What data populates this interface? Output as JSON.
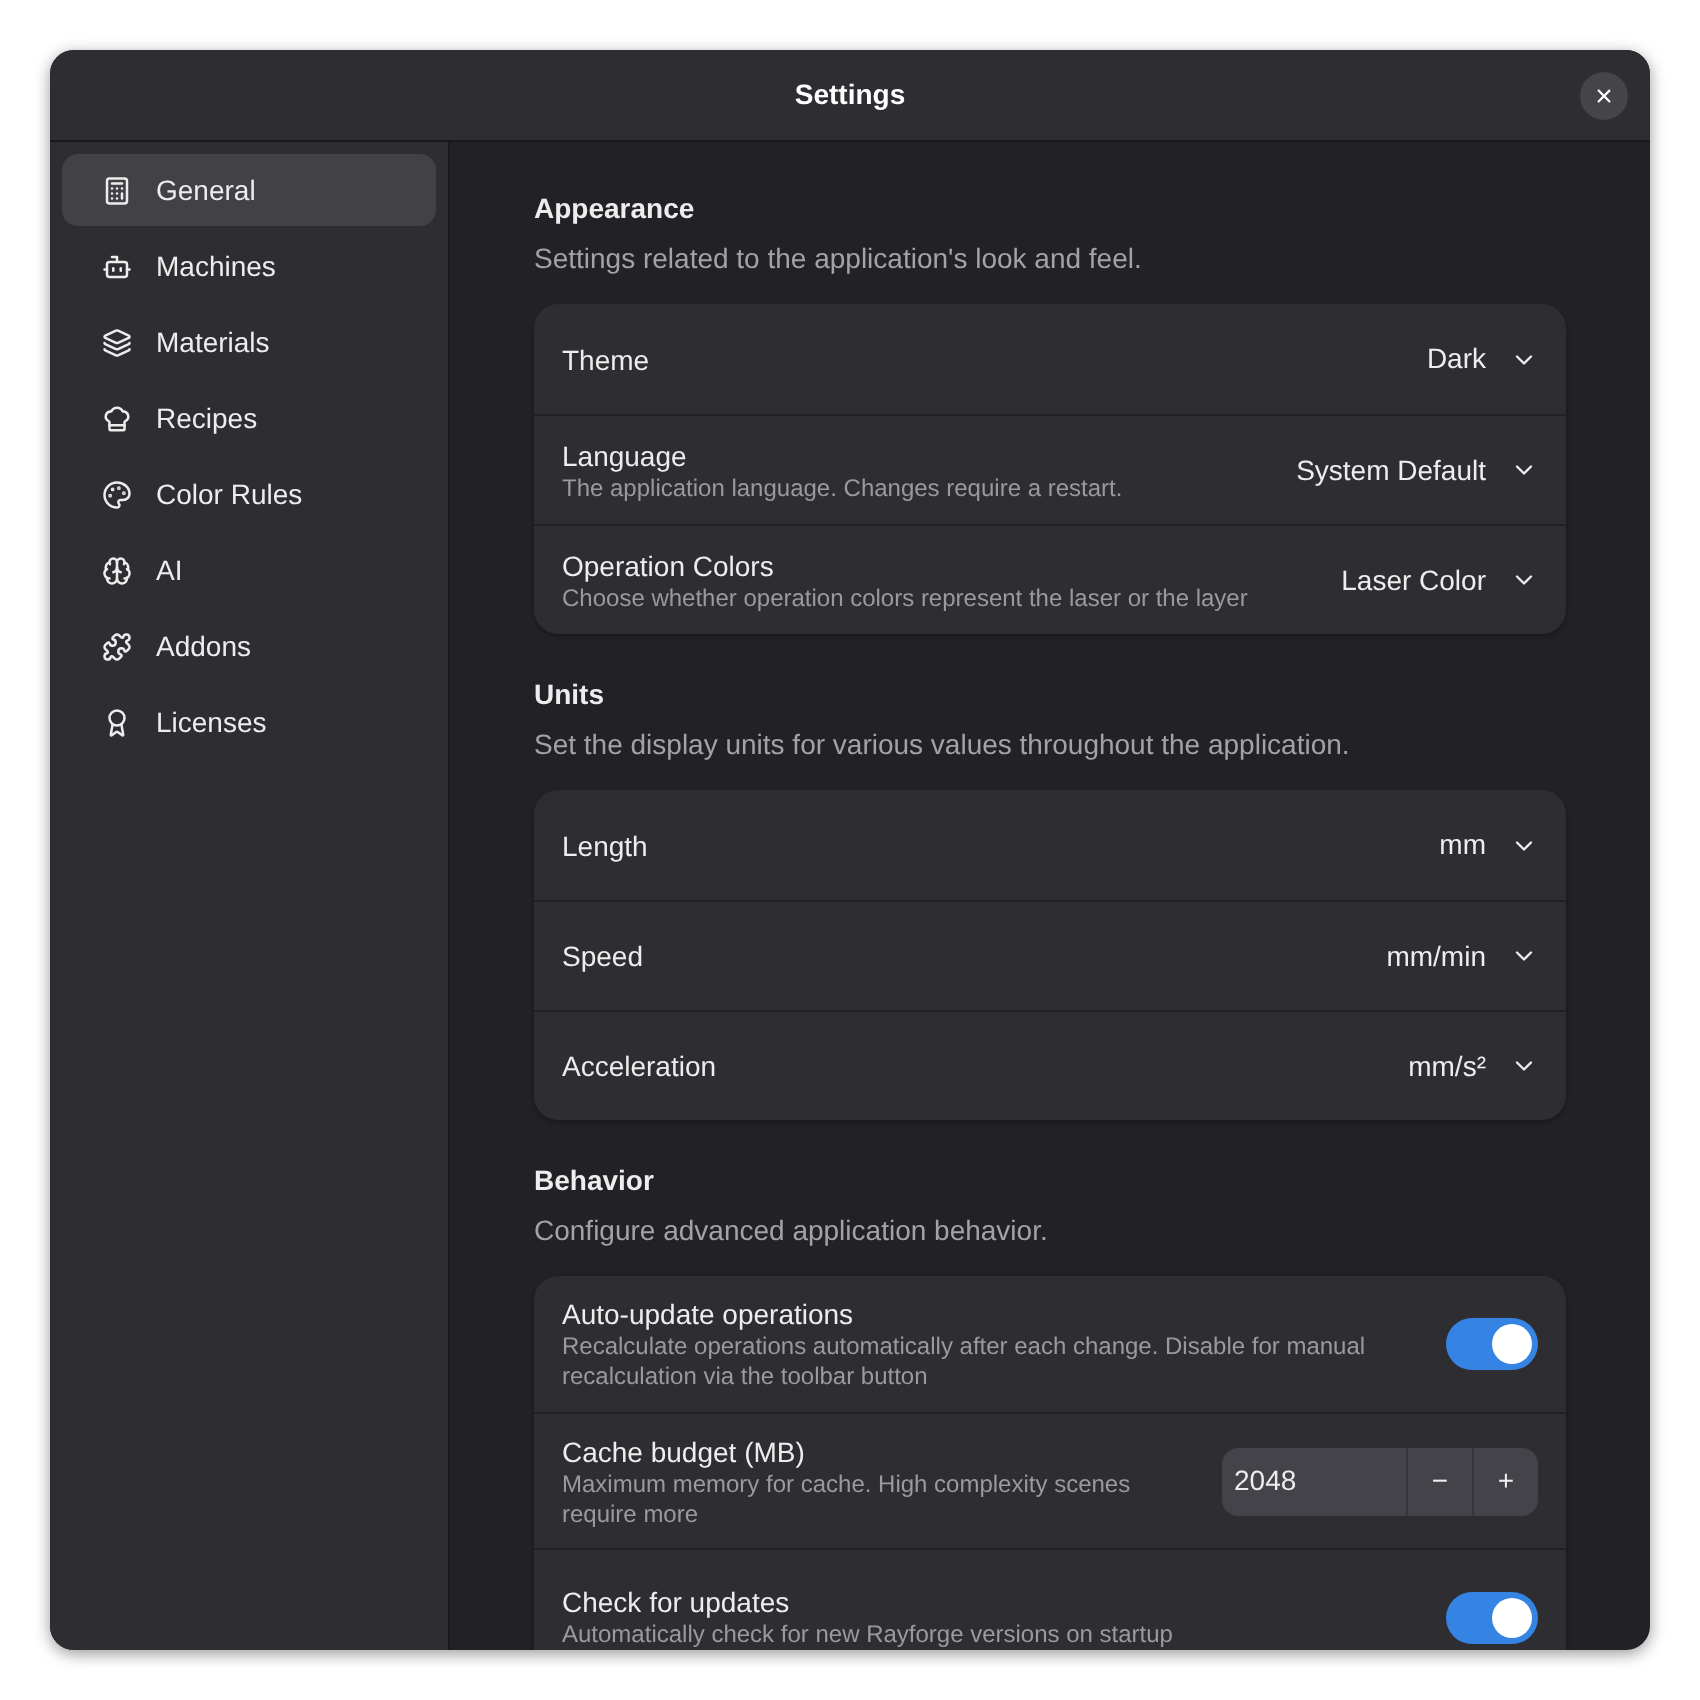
{
  "window": {
    "title": "Settings",
    "close": "×"
  },
  "sidebar": {
    "items": [
      {
        "label": "General",
        "selected": true
      },
      {
        "label": "Machines",
        "selected": false
      },
      {
        "label": "Materials",
        "selected": false
      },
      {
        "label": "Recipes",
        "selected": false
      },
      {
        "label": "Color Rules",
        "selected": false
      },
      {
        "label": "AI",
        "selected": false
      },
      {
        "label": "Addons",
        "selected": false
      },
      {
        "label": "Licenses",
        "selected": false
      }
    ]
  },
  "sections": [
    {
      "title": "Appearance",
      "subtitle": "Settings related to the application's look and feel.",
      "rows": [
        {
          "kind": "dropdown",
          "label": "Theme",
          "value": "Dark"
        },
        {
          "kind": "dropdown",
          "label": "Language",
          "description": "The application language. Changes require a restart.",
          "value": "System Default"
        },
        {
          "kind": "dropdown",
          "label": "Operation Colors",
          "description": "Choose whether operation colors represent the laser or the layer",
          "value": "Laser Color"
        }
      ]
    },
    {
      "title": "Units",
      "subtitle": "Set the display units for various values throughout the application.",
      "rows": [
        {
          "kind": "dropdown",
          "label": "Length",
          "value": "mm"
        },
        {
          "kind": "dropdown",
          "label": "Speed",
          "value": "mm/min"
        },
        {
          "kind": "dropdown",
          "label": "Acceleration",
          "value": "mm/s²"
        }
      ]
    },
    {
      "title": "Behavior",
      "subtitle": "Configure advanced application behavior.",
      "rows": [
        {
          "kind": "switch",
          "label": "Auto-update operations",
          "description": "Recalculate operations automatically after each change. Disable for manual recalculation via the toolbar button",
          "on": true
        },
        {
          "kind": "spin",
          "label": "Cache budget (MB)",
          "description": "Maximum memory for cache. High complexity scenes require more",
          "value": "2048",
          "minus": "−",
          "plus": "+"
        },
        {
          "kind": "switch",
          "label": "Check for updates",
          "description": "Automatically check for new Rayforge versions on startup",
          "on": true
        }
      ]
    }
  ]
}
